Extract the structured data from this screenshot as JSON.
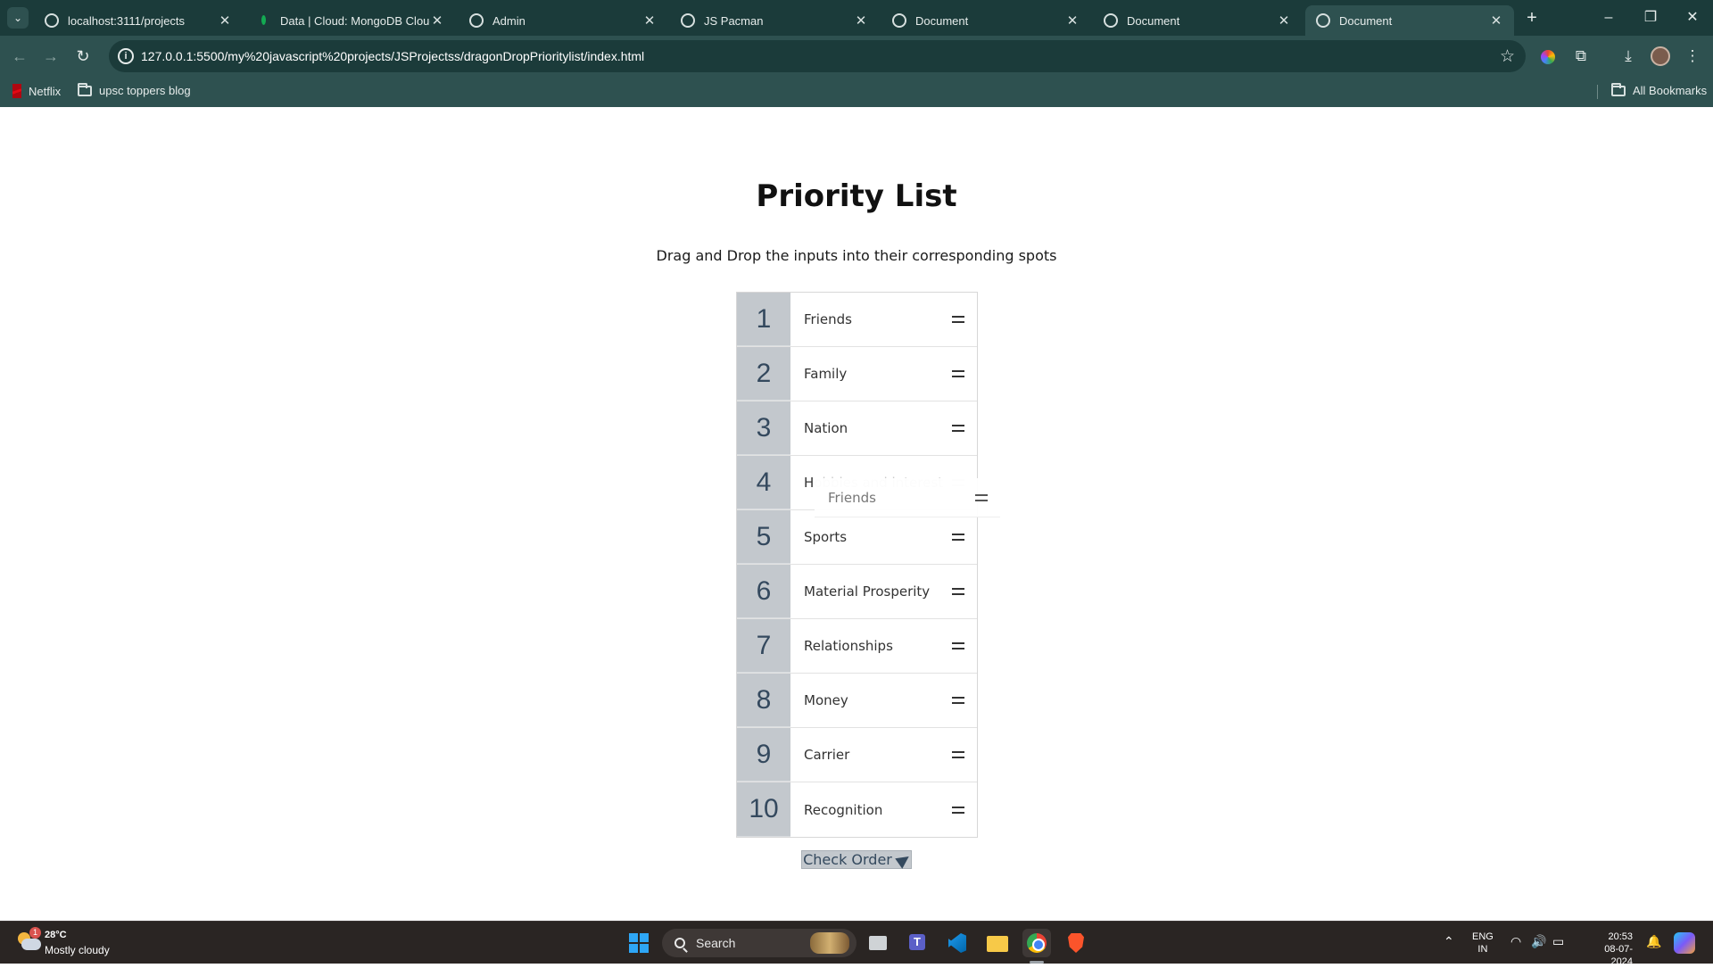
{
  "browser": {
    "tabs": [
      {
        "title": "localhost:3111/projects",
        "active": false
      },
      {
        "title": "Data | Cloud: MongoDB Cloud",
        "active": false
      },
      {
        "title": "Admin",
        "active": false
      },
      {
        "title": "JS Pacman",
        "active": false
      },
      {
        "title": "Document",
        "active": false
      },
      {
        "title": "Document",
        "active": false
      },
      {
        "title": "Document",
        "active": true
      }
    ],
    "url": "127.0.0.1:5500/my%20javascript%20projects/JSProjectss/dragonDropPrioritylist/index.html",
    "bookmarks": [
      {
        "label": "Netflix"
      },
      {
        "label": "upsc toppers blog"
      }
    ],
    "all_bookmarks_label": "All Bookmarks"
  },
  "page": {
    "title": "Priority List",
    "instructions": "Drag and Drop the inputs into their corresponding spots",
    "items": [
      {
        "rank": "1",
        "label": "Friends"
      },
      {
        "rank": "2",
        "label": "Family"
      },
      {
        "rank": "3",
        "label": "Nation"
      },
      {
        "rank": "4",
        "label": "Hobbies and interest",
        "label_first": "H",
        "label_rest": "obbies and interest"
      },
      {
        "rank": "5",
        "label": "Sports"
      },
      {
        "rank": "6",
        "label": "Material Prosperity"
      },
      {
        "rank": "7",
        "label": "Relationships"
      },
      {
        "rank": "8",
        "label": "Money"
      },
      {
        "rank": "9",
        "label": "Carrier"
      },
      {
        "rank": "10",
        "label": "Recognition"
      }
    ],
    "drag_ghost_label": "Friends",
    "check_button_label": "Check Order"
  },
  "taskbar": {
    "weather_temp": "28°C",
    "weather_desc": "Mostly cloudy",
    "weather_badge": "1",
    "search_label": "Search",
    "lang_line1": "ENG",
    "lang_line2": "IN",
    "time": "20:53",
    "date": "08-07-2024"
  }
}
